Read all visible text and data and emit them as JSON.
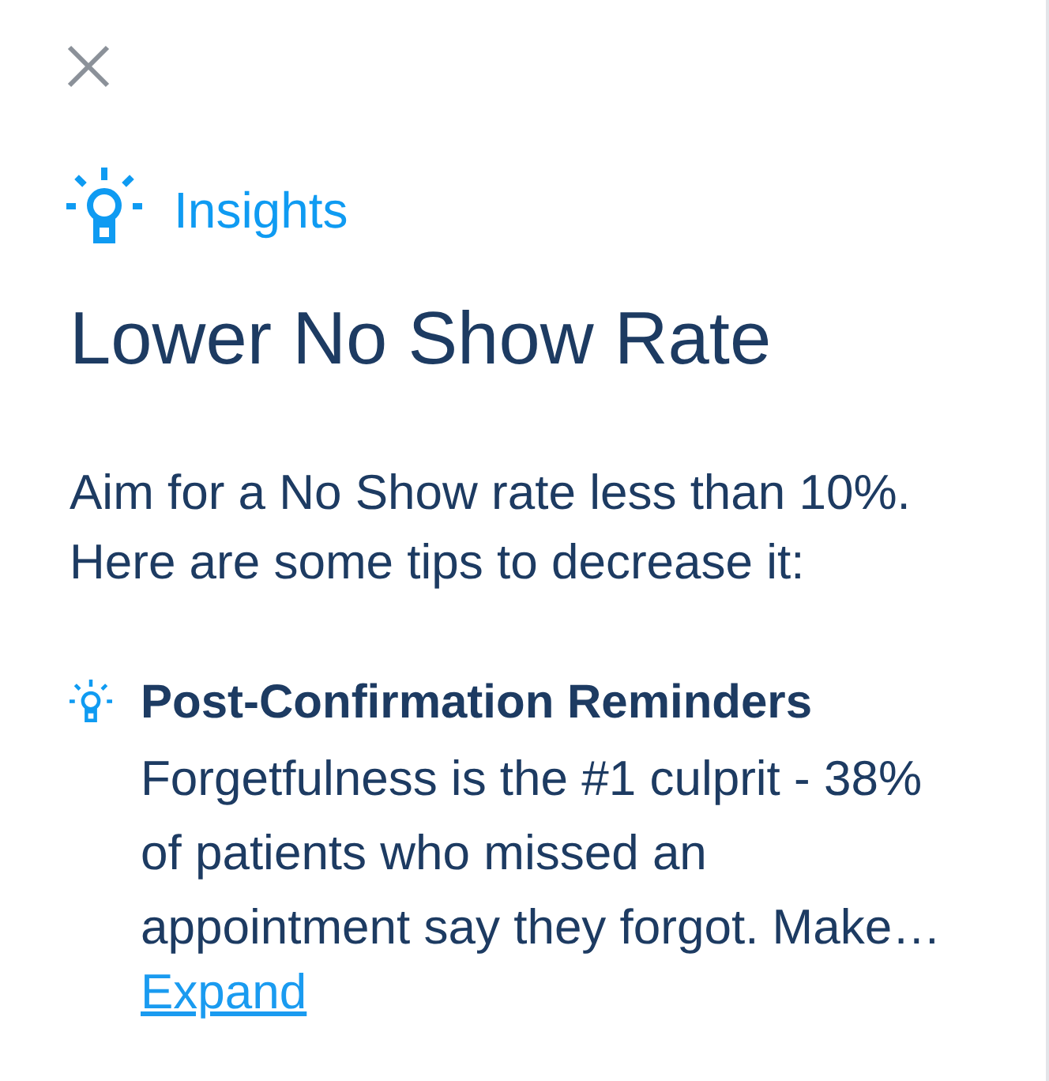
{
  "header": {
    "label": "Insights"
  },
  "title": "Lower No Show Rate",
  "intro_lines": [
    "Aim for a No Show rate less than 10%.",
    "Here are some tips to decrease it:"
  ],
  "tips": [
    {
      "title": "Post-Confirmation Reminders",
      "text_lines": [
        "Forgetfulness is the #1 culprit - 38%",
        "of patients who missed an",
        "appointment say they forgot. Make…"
      ],
      "link": "Expand"
    }
  ]
}
